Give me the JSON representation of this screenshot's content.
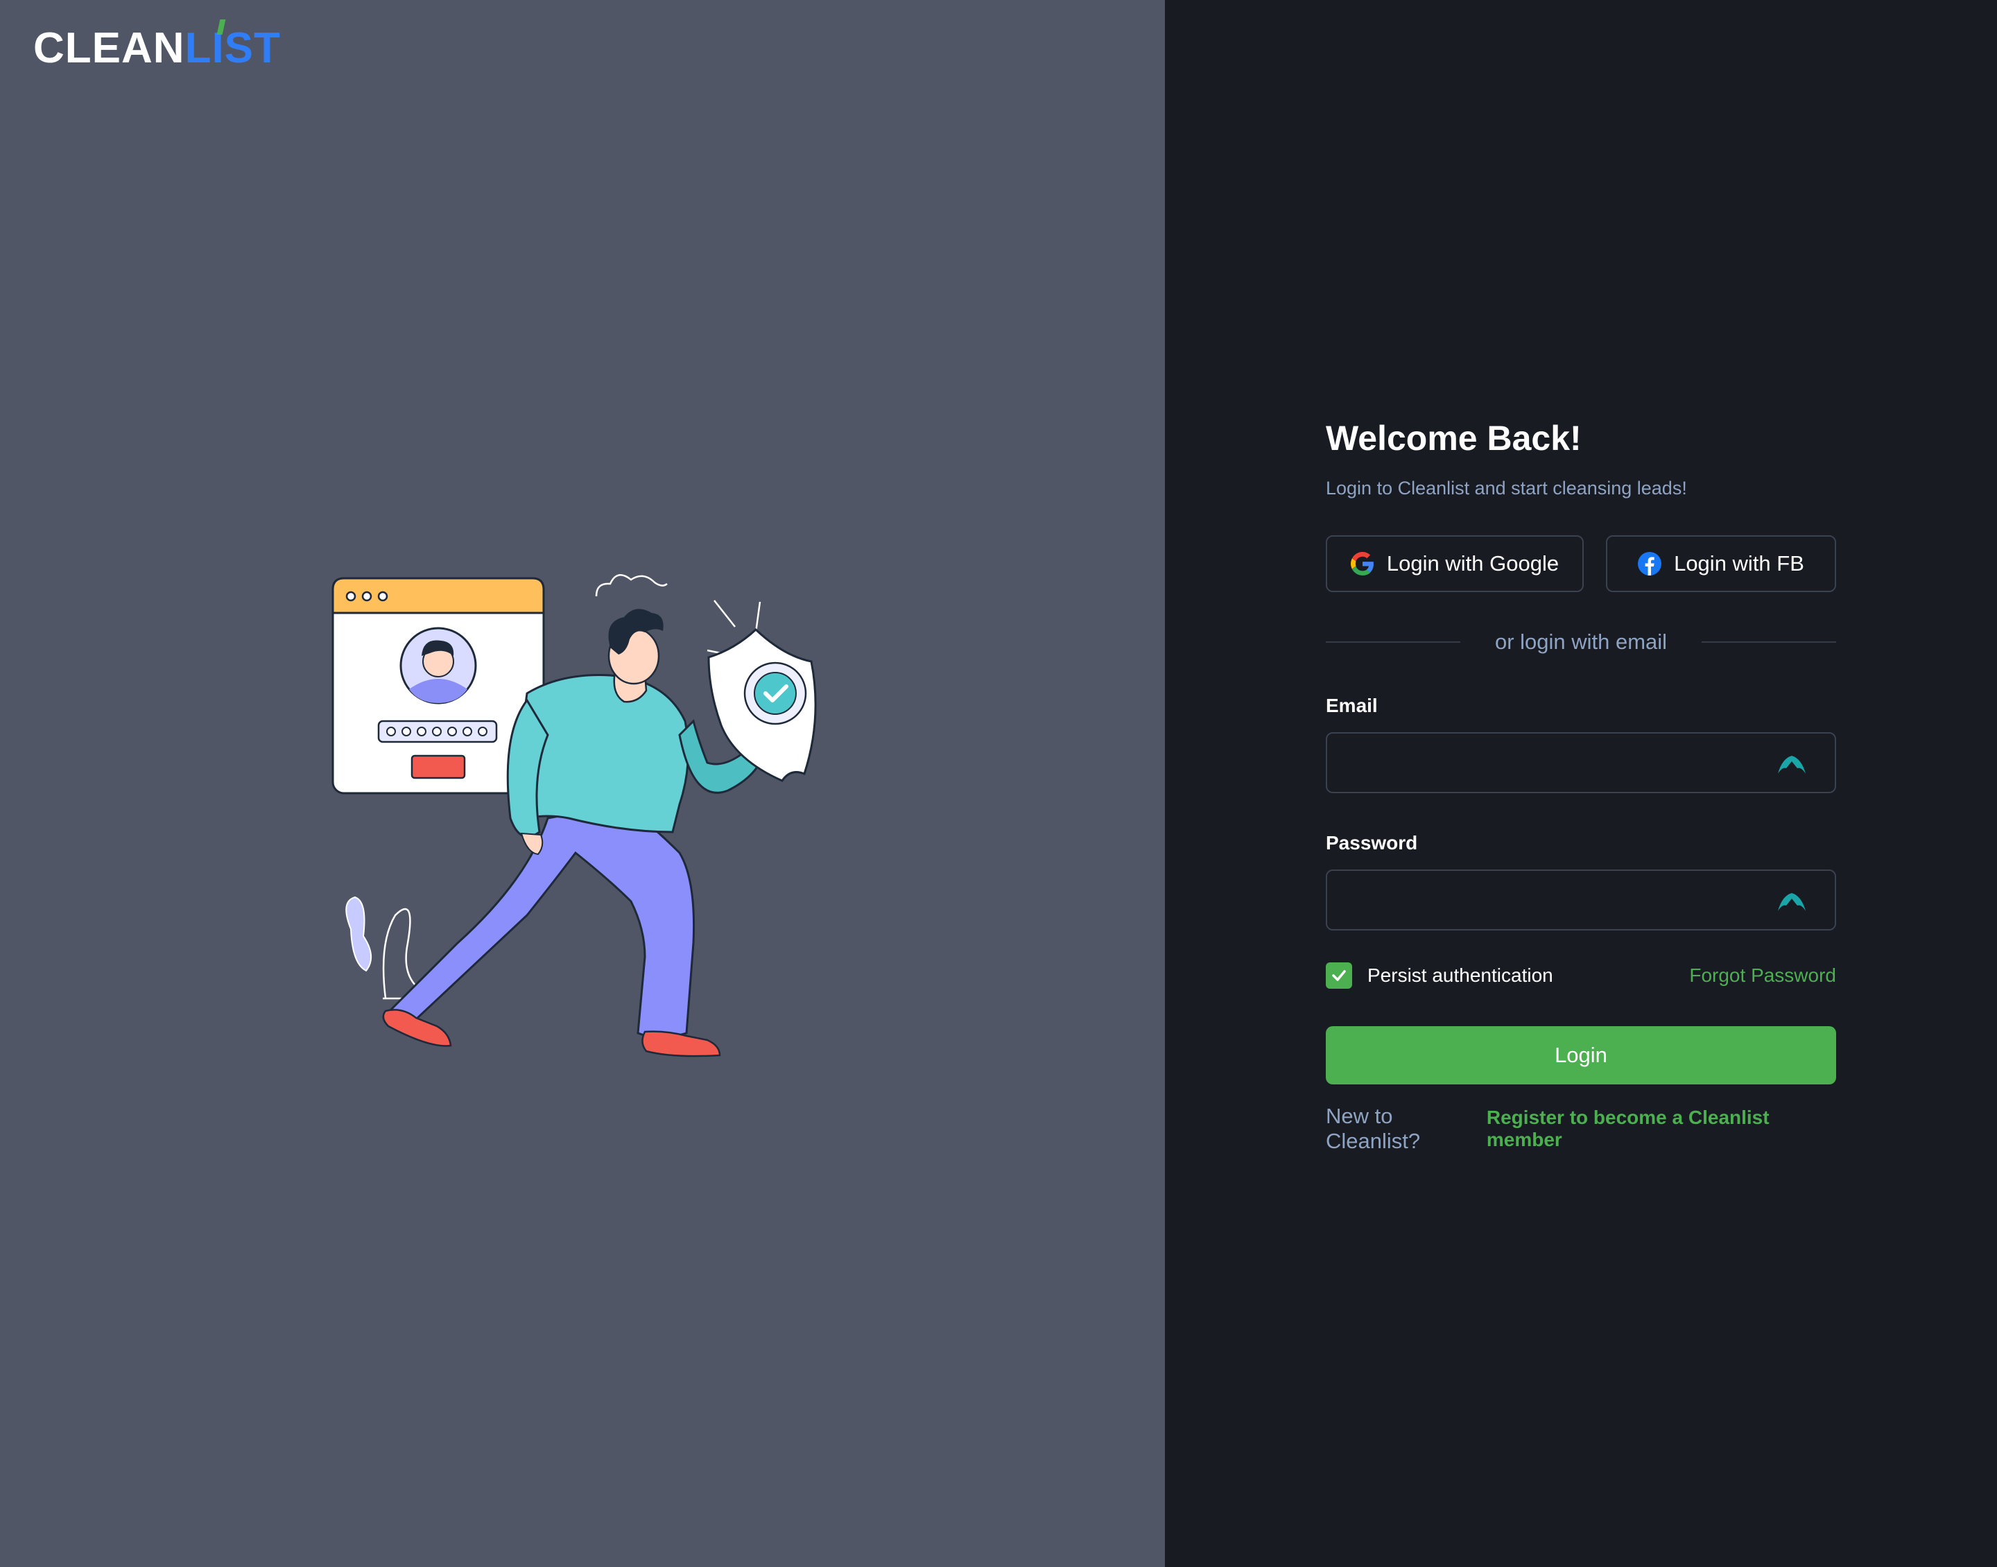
{
  "brand": {
    "part1": "CLEAN",
    "part2_i": "I",
    "part2_rest": "ST"
  },
  "login": {
    "title": "Welcome Back!",
    "subtitle": "Login to Cleanlist and start cleansing leads!",
    "google_label": "Login with Google",
    "fb_label": "Login with FB",
    "divider": "or login with email",
    "email_label": "Email",
    "email_value": "",
    "password_label": "Password",
    "password_value": "",
    "persist_label": "Persist authentication",
    "persist_checked": true,
    "forgot_label": "Forgot Password",
    "submit_label": "Login",
    "register_prompt": "New to Cleanlist?",
    "register_link": "Register to become a Cleanlist member"
  },
  "colors": {
    "left_bg": "#505665",
    "right_bg": "#181b22",
    "accent_green": "#4caf50",
    "brand_blue": "#2f7ef7",
    "muted_text": "#8fa3c2"
  },
  "icons": {
    "google": "google-icon",
    "facebook": "facebook-icon",
    "field_extension": "extension-icon",
    "checkbox": "check-icon"
  }
}
